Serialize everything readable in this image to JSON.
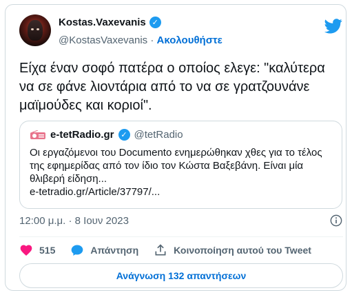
{
  "author": {
    "name": "Kostas.Vaxevanis",
    "handle": "@KostasVaxevanis",
    "separator": "·",
    "follow_label": "Ακολουθήστε"
  },
  "tweet": {
    "text": "Είχα έναν σοφό πατέρα ο οποίος ελεγε: \"καλύτερα να σε φάνε λιοντάρια από το να σε γρατζουνάνε μαϊμούδες και κοριοί\"."
  },
  "quote": {
    "name": "e-tetRadio.gr",
    "handle": "@tetRadio",
    "text": "Οι εργαζόμενοι του Documento ενημερώθηκαν χθες για το τέλος της εφημερίδας από τον ίδιο τον Κώστα Βαξεβάνη. Είναι μία θλιβερή είδηση...",
    "link": "e-tetradio.gr/Article/37797/..."
  },
  "meta": {
    "timestamp": "12:00 μ.μ. · 8 Ιουν 2023"
  },
  "actions": {
    "likes": "515",
    "reply_label": "Απάντηση",
    "share_label": "Κοινοποίηση αυτού του Tweet"
  },
  "replies_button": {
    "label": "Ανάγνωση 132 απαντήσεων"
  },
  "colors": {
    "accent": "#1d9bf0",
    "link": "#006fd6",
    "like": "#f91880",
    "muted": "#536471"
  }
}
